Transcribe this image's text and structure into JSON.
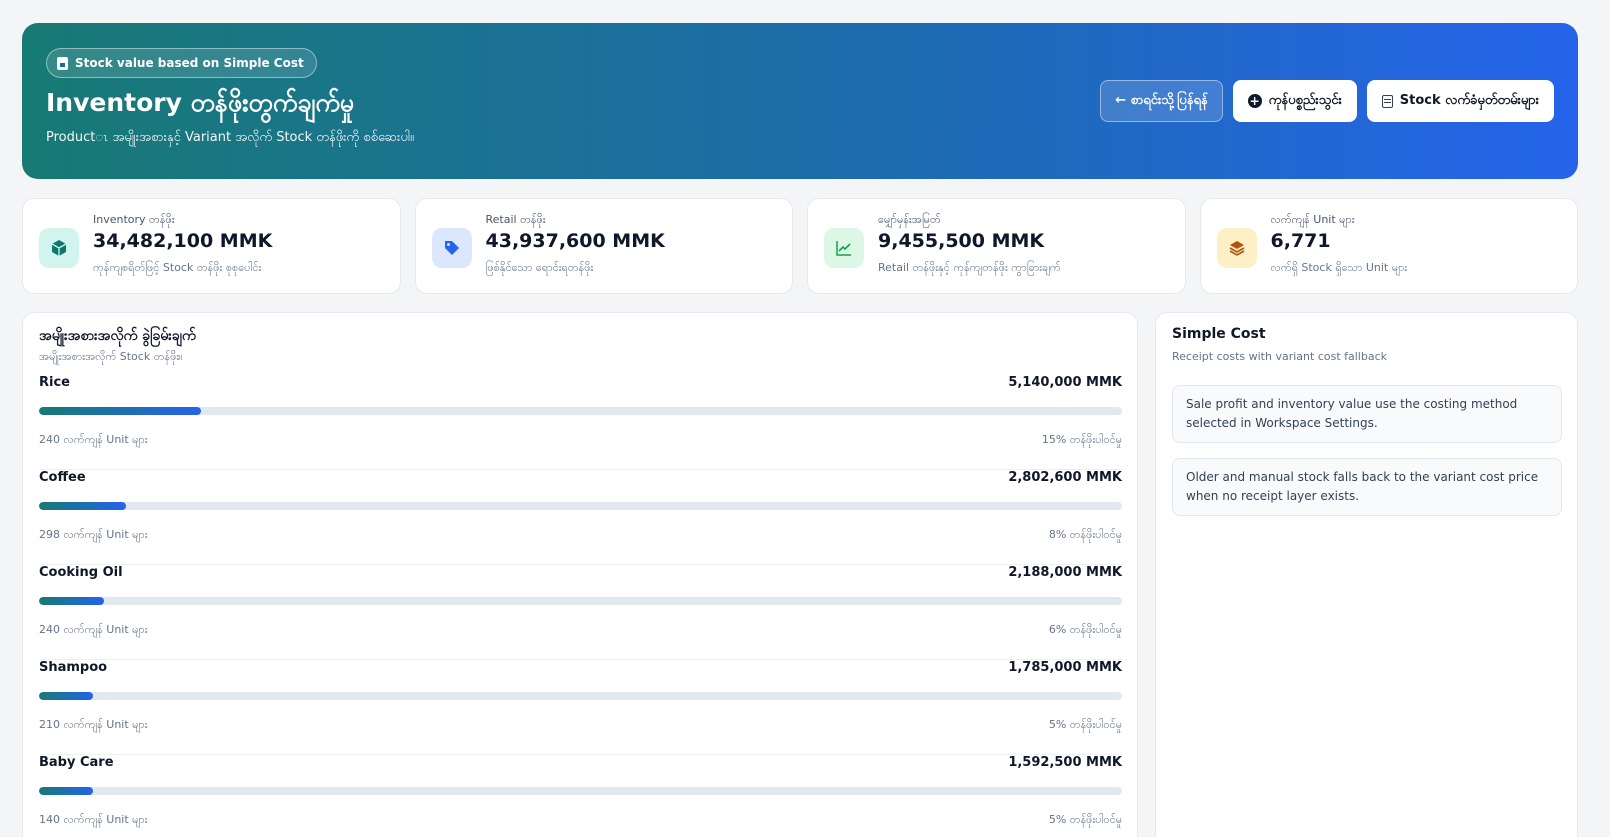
{
  "hero": {
    "badge": "Stock value based on Simple Cost",
    "title": "Inventory တန်ဖိုးတွက်ချက်မှု",
    "subtitle": "Productၤ အမျိုးအစားနှင့် Variant အလိုက် Stock တန်ဖိုးကို စစ်ဆေးပါ။",
    "buttons": {
      "back": "← စာရင်းသို့ပြန်ရန်",
      "add_goods": "ကုန်ပစ္စည်းသွင်း",
      "stock_records": "Stock လက်ခံမှတ်တမ်းများ"
    }
  },
  "stats": [
    {
      "icon": "cube-icon",
      "label": "Inventory တန်ဖိုး",
      "value": "34,482,100 MMK",
      "desc": "ကုန်ကျစရိတ်ဖြင့် Stock တန်ဖိုး စုစုပေါင်း",
      "color": "#0f766e",
      "bg": "#d1f5ee"
    },
    {
      "icon": "tag-icon",
      "label": "Retail တန်ဖိုး",
      "value": "43,937,600 MMK",
      "desc": "ဖြစ်နိုင်သော ရောင်းရတန်ဖိုး",
      "color": "#2563eb",
      "bg": "#dbe7fd"
    },
    {
      "icon": "trend-icon",
      "label": "မျှော်မှန်းအမြတ်",
      "value": "9,455,500 MMK",
      "desc": "Retail တန်ဖိုးနှင့် ကုန်ကျတန်ဖိုး ကွာခြားချက်",
      "color": "#16a34a",
      "bg": "#dcf7e6"
    },
    {
      "icon": "layers-icon",
      "label": "လက်ကျန် Unit များ",
      "value": "6,771",
      "desc": "လက်ရှိ Stock ရှိသော Unit များ",
      "color": "#b45309",
      "bg": "#fdf0c6"
    }
  ],
  "categories": {
    "title": "အမျိုးအစားအလိုက် ခွဲခြမ်းချက်",
    "subtitle": "အမျိုးအစားအလိုက် Stock တန်ဖိုး။",
    "items": [
      {
        "name": "Rice",
        "value": "5,140,000 MMK",
        "units": "240 လက်ကျန် Unit များ",
        "share": "15% တန်ဖိုးပါဝင်မှု",
        "pct": 15
      },
      {
        "name": "Coffee",
        "value": "2,802,600 MMK",
        "units": "298 လက်ကျန် Unit များ",
        "share": "8% တန်ဖိုးပါဝင်မှု",
        "pct": 8
      },
      {
        "name": "Cooking Oil",
        "value": "2,188,000 MMK",
        "units": "240 လက်ကျန် Unit များ",
        "share": "6% တန်ဖိုးပါဝင်မှု",
        "pct": 6
      },
      {
        "name": "Shampoo",
        "value": "1,785,000 MMK",
        "units": "210 လက်ကျန် Unit များ",
        "share": "5% တန်ဖိုးပါဝင်မှု",
        "pct": 5
      },
      {
        "name": "Baby Care",
        "value": "1,592,500 MMK",
        "units": "140 လက်ကျန် Unit များ",
        "share": "5% တန်ဖိုးပါဝင်မှု",
        "pct": 5
      }
    ]
  },
  "costing": {
    "title": "Simple Cost",
    "subtitle": "Receipt costs with variant cost fallback",
    "notes": [
      "Sale profit and inventory value use the costing method selected in Workspace Settings.",
      "Older and manual stock falls back to the variant cost price when no receipt layer exists."
    ]
  }
}
